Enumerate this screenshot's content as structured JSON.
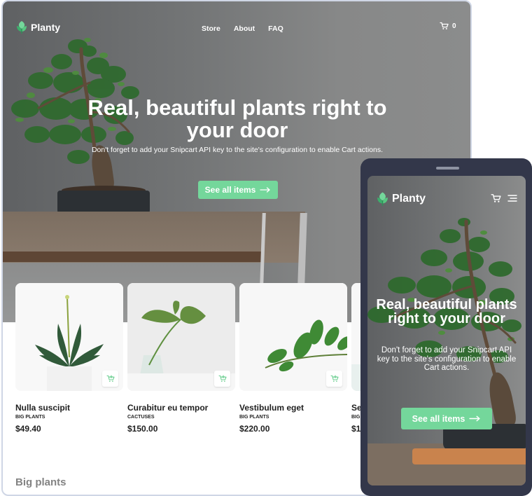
{
  "desktop": {
    "brand": "Planty",
    "nav": [
      "Store",
      "About",
      "FAQ"
    ],
    "cart_count": "0",
    "hero": {
      "title": "Real, beautiful plants right to your door",
      "subtitle": "Don't forget to add your Snipcart API key to the site's configuration to enable Cart actions.",
      "cta": "See all items"
    },
    "products": [
      {
        "name": "Nulla suscipit",
        "category": "BIG PLANTS",
        "price": "$49.40"
      },
      {
        "name": "Curabitur eu tempor",
        "category": "CACTUSES",
        "price": "$150.00"
      },
      {
        "name": "Vestibulum eget",
        "category": "BIG PLANTS",
        "price": "$220.00"
      },
      {
        "name": "Sed",
        "category": "BIG",
        "price": "$1"
      }
    ],
    "section_heading": "Big plants"
  },
  "mobile": {
    "brand": "Planty",
    "hero": {
      "title": "Real, beautiful plants right to your door",
      "subtitle": "Don't forget to add your Snipcart API key to the site's configuration to enable Cart actions.",
      "cta": "See all items"
    }
  },
  "icons": {
    "brand": "leaf-logo-icon",
    "cart": "cart-icon",
    "menu": "menu-icon",
    "arrow": "arrow-right-icon",
    "add_to_cart": "add-to-cart-icon"
  },
  "colors": {
    "accent": "#74d79b",
    "icon_green": "#6ccf91",
    "device_frame": "#33374a",
    "border": "#cfd6e5",
    "muted_heading": "#838383"
  }
}
